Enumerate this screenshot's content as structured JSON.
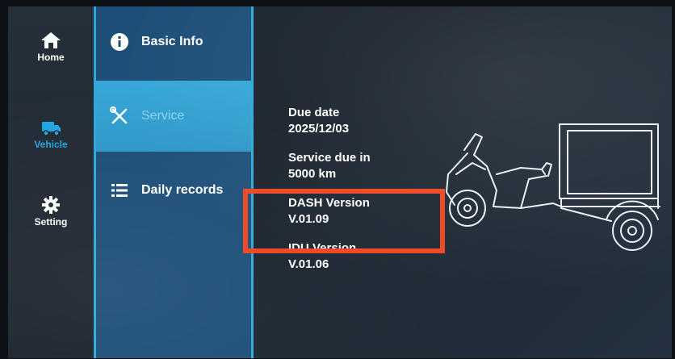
{
  "rail": {
    "items": [
      {
        "label": "Home",
        "icon": "home-icon"
      },
      {
        "label": "Vehicle",
        "icon": "vehicle-icon",
        "active": true
      },
      {
        "label": "Setting",
        "icon": "gear-icon"
      }
    ]
  },
  "menu": {
    "items": [
      {
        "label": "Basic Info",
        "icon": "info-icon"
      },
      {
        "label": "Service",
        "icon": "tools-icon",
        "selected": true
      },
      {
        "label": "Daily records",
        "icon": "list-icon"
      }
    ]
  },
  "service": {
    "fields": [
      {
        "label": "Due date",
        "value": "2025/12/03"
      },
      {
        "label": "Service due in",
        "value": "5000 km"
      },
      {
        "label": "DASH Version",
        "value": "V.01.09"
      },
      {
        "label": "IDU Version",
        "value": "V.01.06"
      }
    ]
  },
  "colors": {
    "accent": "#2ea9d6",
    "active_rail": "#1fa6e0",
    "highlight": "#ef4523",
    "menu_bg": "#1e4f78"
  }
}
